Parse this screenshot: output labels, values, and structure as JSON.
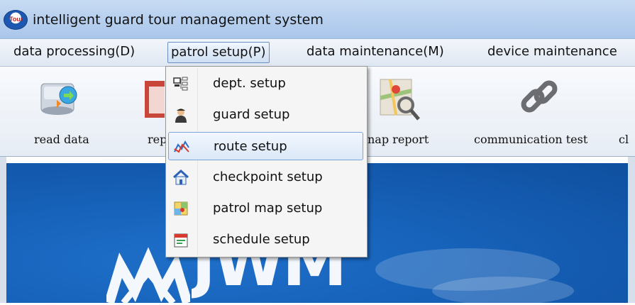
{
  "window": {
    "title": "intelligent guard tour management system",
    "app_icon_text": "Tour"
  },
  "menubar": {
    "items": [
      {
        "label": "data processing(D)"
      },
      {
        "label": "patrol setup(P)"
      },
      {
        "label": "data maintenance(M)"
      },
      {
        "label": "device maintenance"
      }
    ],
    "active_index": 1
  },
  "toolbar": {
    "items": [
      {
        "label": "read data",
        "icon": "read-data-icon"
      },
      {
        "label": "rep",
        "icon": "report-icon"
      },
      {
        "label": "nap report",
        "icon": "map-report-icon"
      },
      {
        "label": "communication test",
        "icon": "chain-link-icon"
      },
      {
        "label": "cl",
        "icon": ""
      }
    ]
  },
  "dropdown": {
    "items": [
      {
        "label": "dept. setup",
        "icon": "department-tree-icon"
      },
      {
        "label": "guard setup",
        "icon": "guard-person-icon"
      },
      {
        "label": "route setup",
        "icon": "route-chart-icon"
      },
      {
        "label": "checkpoint setup",
        "icon": "house-icon"
      },
      {
        "label": "patrol map setup",
        "icon": "patrol-map-icon"
      },
      {
        "label": "schedule setup",
        "icon": "calendar-icon"
      }
    ],
    "hover_index": 2
  },
  "main": {
    "logo_text": "JWM"
  },
  "colors": {
    "accent": "#1763bb",
    "titlebar": "#b9d1ef",
    "menu_hover_border": "#7aa5d9"
  }
}
